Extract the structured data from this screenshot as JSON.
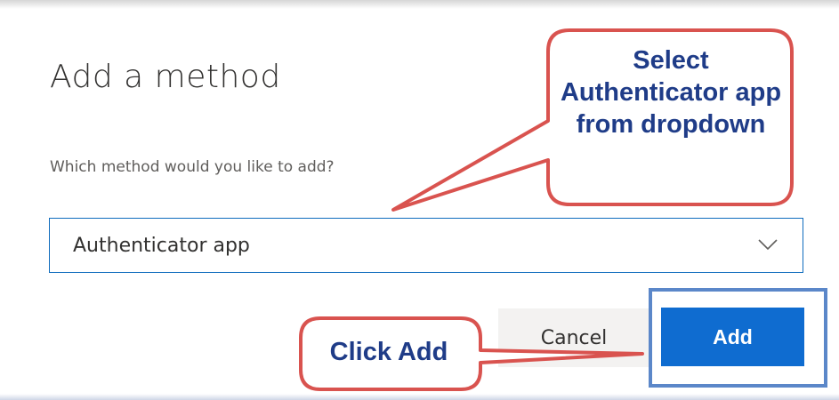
{
  "dialog": {
    "title": "Add a method",
    "question": "Which method would you like to add?",
    "selected_method": "Authenticator app",
    "cancel_label": "Cancel",
    "add_label": "Add"
  },
  "annotations": {
    "select_callout": "Select Authenticator app from dropdown",
    "add_callout": "Click Add"
  },
  "icons": {
    "dropdown": "chevron-down-icon"
  },
  "colors": {
    "primary_button": "#0f6cd0",
    "callout_border": "#d9534f",
    "callout_text": "#1f3c88",
    "highlight_frame": "#5b87c9"
  }
}
